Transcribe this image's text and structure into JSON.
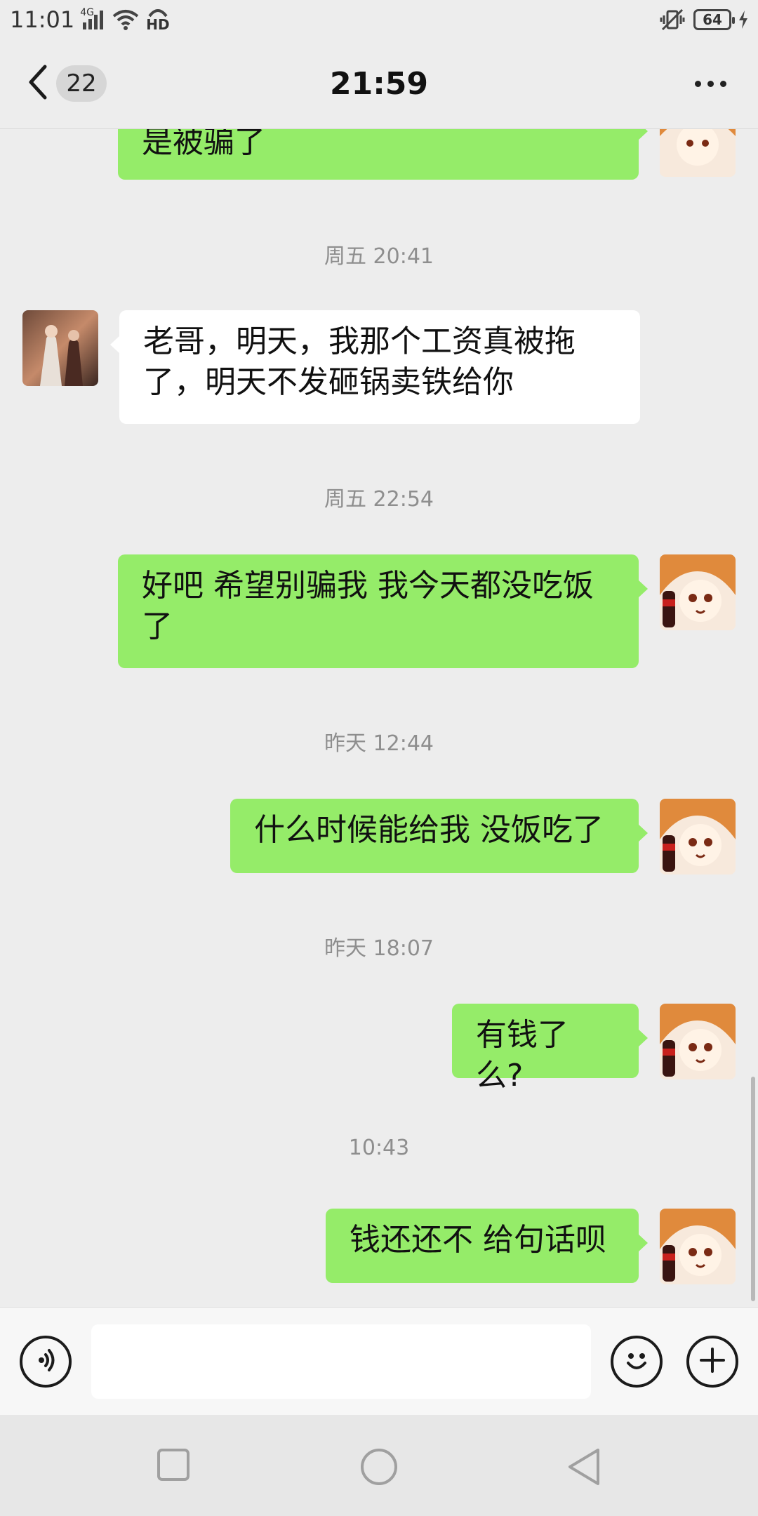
{
  "status_bar": {
    "time": "11:01",
    "network": "4G",
    "hd": "HD",
    "battery": "64"
  },
  "header": {
    "unread_count": "22",
    "title": "21:59"
  },
  "messages": [
    {
      "kind": "sent",
      "text": "是被骗了"
    },
    {
      "kind": "timestamp",
      "text": "周五 20:41"
    },
    {
      "kind": "received",
      "text": "老哥，明天，我那个工资真被拖了，明天不发砸锅卖铁给你"
    },
    {
      "kind": "timestamp",
      "text": "周五 22:54"
    },
    {
      "kind": "sent",
      "text": "好吧  希望别骗我 我今天都没吃饭了"
    },
    {
      "kind": "timestamp",
      "text": "昨天 12:44"
    },
    {
      "kind": "sent",
      "text": "什么时候能给我  没饭吃了"
    },
    {
      "kind": "timestamp",
      "text": "昨天 18:07"
    },
    {
      "kind": "sent",
      "text": "有钱了么?"
    },
    {
      "kind": "timestamp",
      "text": "10:43"
    },
    {
      "kind": "sent",
      "text": "钱还还不  给句话呗"
    }
  ],
  "input": {
    "value": "",
    "placeholder": ""
  },
  "icons": {
    "back": "chevron-left-icon",
    "more": "more-dots-icon",
    "voice": "voice-icon",
    "emoji": "emoji-icon",
    "plus": "plus-icon",
    "nav_recent": "square-icon",
    "nav_home": "circle-icon",
    "nav_back": "triangle-icon"
  },
  "colors": {
    "sent_bubble": "#95ec69",
    "received_bubble": "#ffffff",
    "background": "#ededed"
  }
}
